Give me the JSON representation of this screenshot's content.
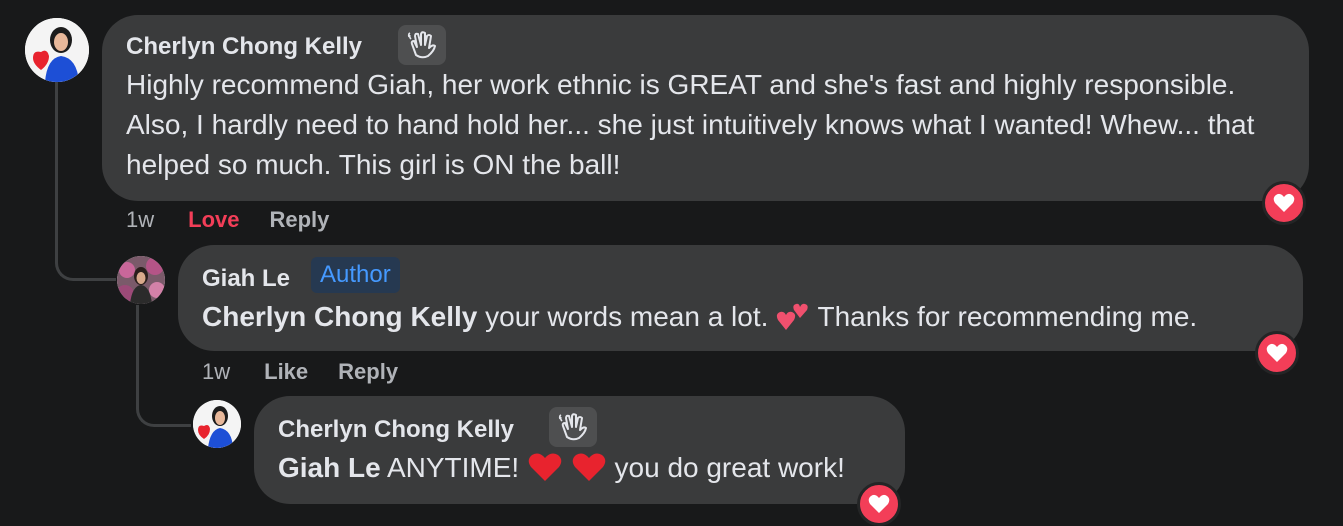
{
  "comments": [
    {
      "author": "Cherlyn Chong Kelly",
      "badge_icon": "wave-icon",
      "text": "Highly recommend Giah, her work ethnic is GREAT and she's fast and highly responsible. Also, I hardly need to hand hold her... she just intuitively knows what I wanted! Whew... that helped so much. This girl is ON the ball!",
      "time": "1w",
      "like_label": "Love",
      "reply_label": "Reply",
      "reaction": "heart"
    },
    {
      "author": "Giah Le",
      "badge_label": "Author",
      "mention": "Cherlyn Chong Kelly",
      "text_before_emoji": " your words mean a lot. ",
      "text_after_emoji": " Thanks for recommending me.",
      "time": "1w",
      "like_label": "Like",
      "reply_label": "Reply",
      "reaction": "heart"
    },
    {
      "author": "Cherlyn Chong Kelly",
      "badge_icon": "wave-icon",
      "mention": "Giah Le",
      "text_before_emoji": " ANYTIME! ",
      "text_after_emoji": " you do great work!",
      "reaction": "heart"
    }
  ],
  "colors": {
    "background": "#18191a",
    "bubble": "#3a3b3c",
    "love": "#f33e58",
    "author_badge_text": "#4599ff"
  }
}
